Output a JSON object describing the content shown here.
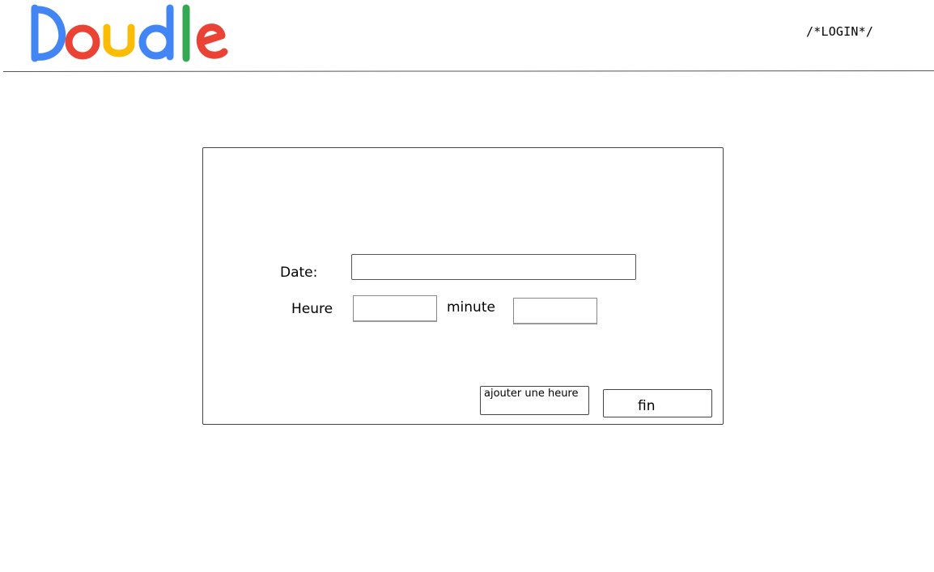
{
  "header": {
    "logo": {
      "letters": [
        {
          "char": "D",
          "color": "#4285F4"
        },
        {
          "char": "o",
          "color": "#EA4335"
        },
        {
          "char": "u",
          "color": "#FBBC05"
        },
        {
          "char": "d",
          "color": "#4285F4"
        },
        {
          "char": "l",
          "color": "#34A853"
        },
        {
          "char": "e",
          "color": "#EA4335"
        }
      ]
    },
    "login_label": "/*LOGIN*/"
  },
  "form": {
    "date_label": "Date:",
    "date_value": "",
    "hour_label": "Heure",
    "hour_value": "",
    "minute_label": "minute",
    "minute_value": "",
    "add_hour_button": "ajouter une heure",
    "finish_button": "fin"
  }
}
